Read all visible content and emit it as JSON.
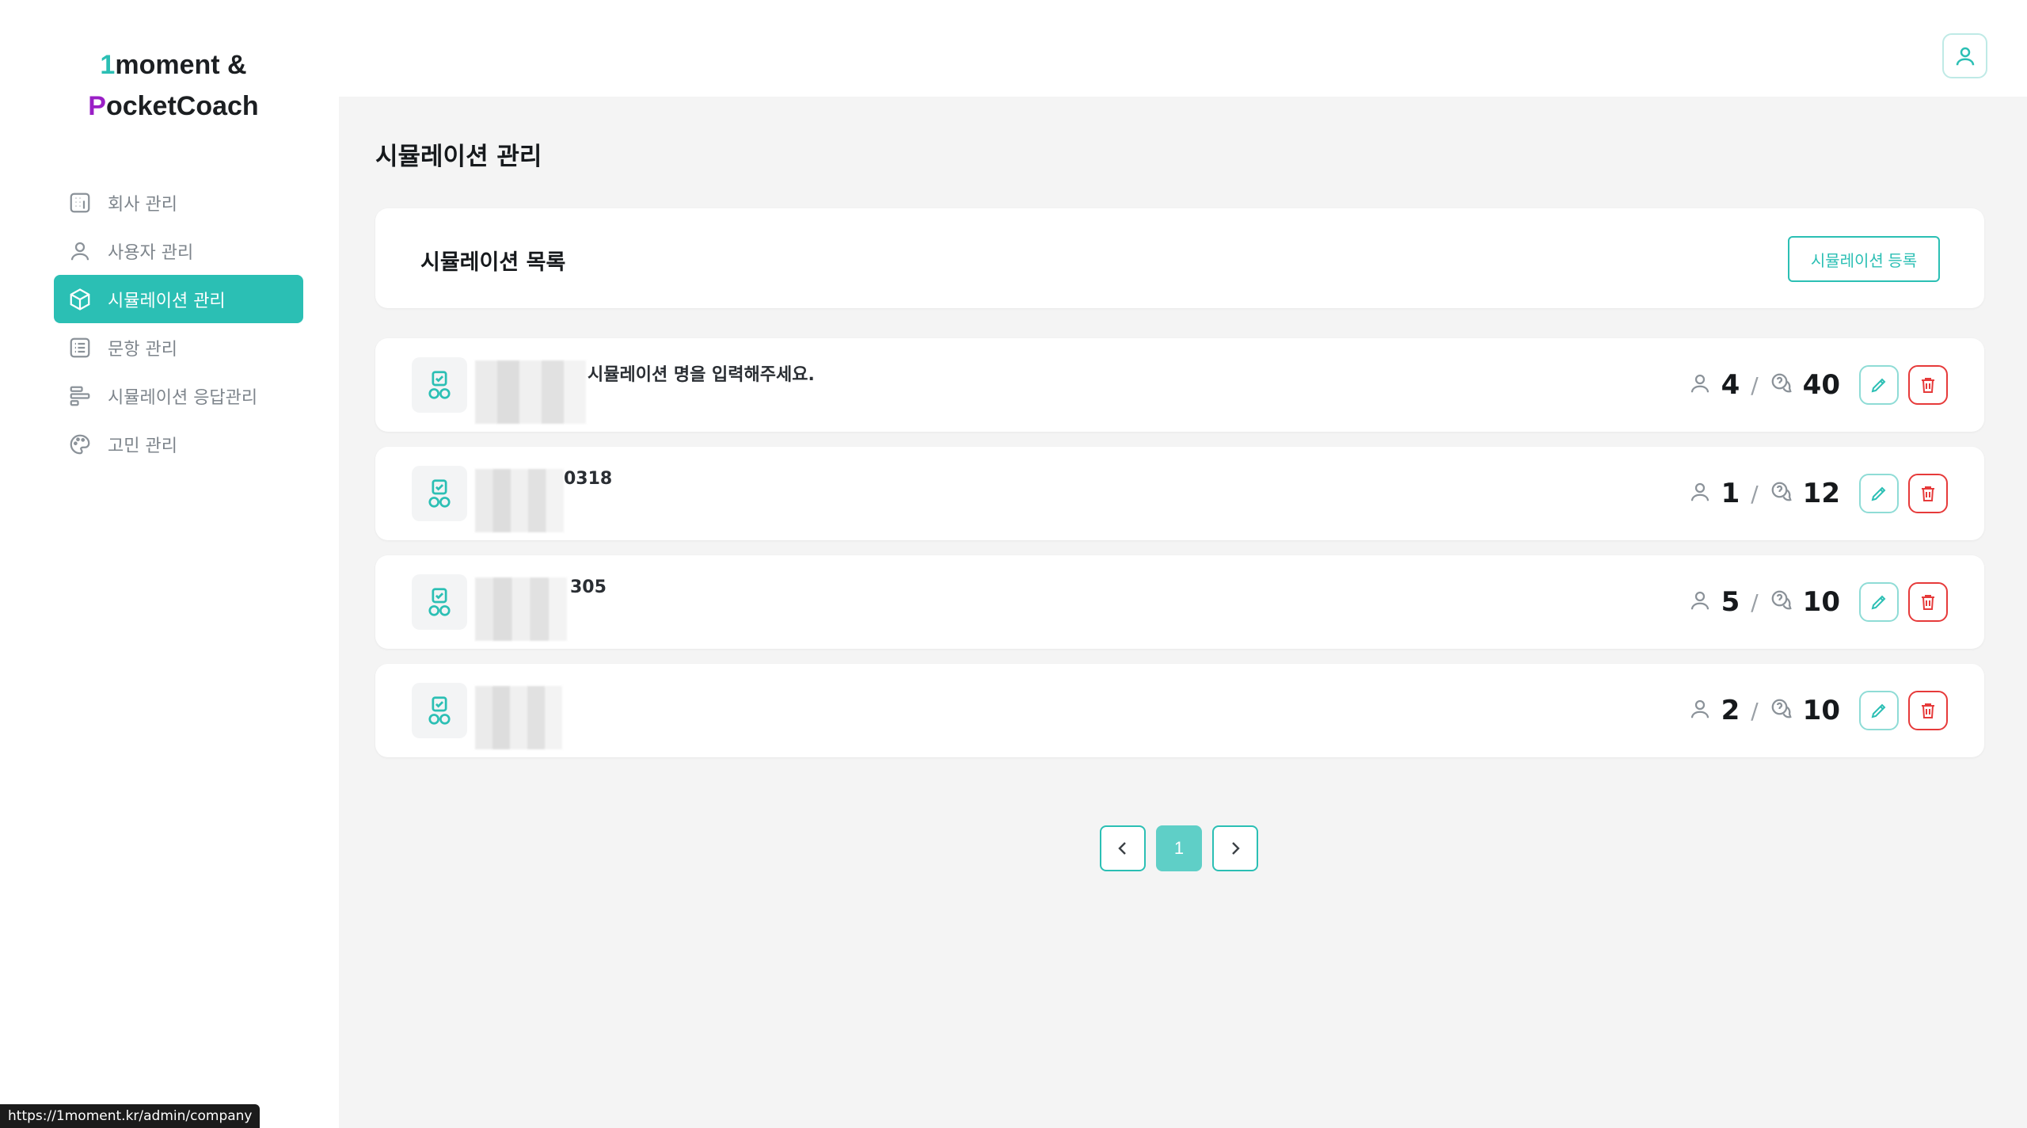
{
  "logo": {
    "line1_accent": "1",
    "line1_rest": "moment &",
    "line2_accent": "P",
    "line2_rest": "ocketCoach"
  },
  "sidebar": {
    "items": [
      {
        "label": "회사 관리",
        "icon": "building-icon",
        "active": false
      },
      {
        "label": "사용자 관리",
        "icon": "user-icon",
        "active": false
      },
      {
        "label": "시뮬레이션 관리",
        "icon": "cube-icon",
        "active": true
      },
      {
        "label": "문항 관리",
        "icon": "list-icon",
        "active": false
      },
      {
        "label": "시뮬레이션 응답관리",
        "icon": "bars-icon",
        "active": false
      },
      {
        "label": "고민 관리",
        "icon": "palette-icon",
        "active": false
      }
    ]
  },
  "page": {
    "title": "시뮬레이션 관리"
  },
  "list": {
    "title": "시뮬레이션 목록",
    "register_label": "시뮬레이션 등록",
    "rows": [
      {
        "name": "시뮬레이션 명을 입력해주세요.",
        "users": "4",
        "questions": "40"
      },
      {
        "name": "0318",
        "users": "1",
        "questions": "12"
      },
      {
        "name": "305",
        "users": "5",
        "questions": "10"
      },
      {
        "name": "",
        "users": "2",
        "questions": "10"
      }
    ]
  },
  "pagination": {
    "current": "1"
  },
  "status_url": "https://1moment.kr/admin/company",
  "colors": {
    "accent": "#2bbfb4",
    "brand_purple": "#9a1fc6",
    "danger": "#e63a3a"
  }
}
